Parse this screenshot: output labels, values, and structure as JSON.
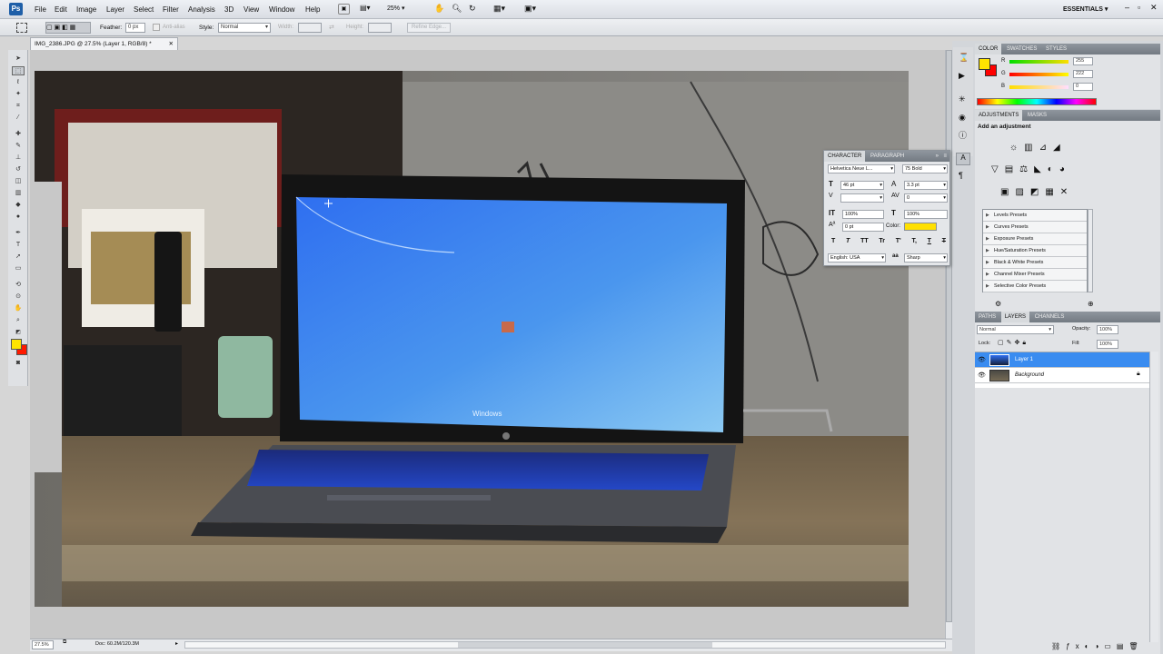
{
  "menubar": {
    "logo": "Ps",
    "items": [
      "File",
      "Edit",
      "Image",
      "Layer",
      "Select",
      "Filter",
      "Analysis",
      "3D",
      "View",
      "Window",
      "Help"
    ],
    "zoom": "25%",
    "workspace": "ESSENTIALS"
  },
  "options": {
    "feather_label": "Feather:",
    "feather_value": "0 px",
    "antialias_label": "Anti-alias",
    "style_label": "Style:",
    "style_value": "Normal",
    "width_label": "Width:",
    "height_label": "Height:",
    "refine_edge": "Refine Edge..."
  },
  "document": {
    "tab_title": "IMG_2386.JPG @ 27.5% (Layer 1, RGB/8) *",
    "screen_text": "Windows"
  },
  "status": {
    "zoom": "27.5%",
    "doc_size": "Doc: 60.2M/120.3M"
  },
  "color_panel": {
    "tabs": [
      "COLOR",
      "SWATCHES",
      "STYLES"
    ],
    "r_label": "R",
    "g_label": "G",
    "b_label": "B",
    "r": "255",
    "g": "222",
    "b": "0",
    "foreground": "#ffe400",
    "background": "#ff0000"
  },
  "adjustments_panel": {
    "tabs": [
      "ADJUSTMENTS",
      "MASKS"
    ],
    "heading": "Add an adjustment",
    "presets": [
      "Levels Presets",
      "Curves Presets",
      "Exposure Presets",
      "Hue/Saturation Presets",
      "Black & White Presets",
      "Channel Mixer Presets",
      "Selective Color Presets"
    ]
  },
  "character_panel": {
    "tabs": [
      "CHARACTER",
      "PARAGRAPH"
    ],
    "font_family": "Helvetica Neue L...",
    "font_style": "75 Bold",
    "font_size": "46 pt",
    "leading": "3.3 pt",
    "tracking": "0",
    "vscale": "100%",
    "hscale": "100%",
    "baseline": "0 pt",
    "color_label": "Color:",
    "color": "#ffe000",
    "language": "English: USA",
    "aa_label": "aa",
    "antialias": "Sharp",
    "style_buttons": [
      "T",
      "T",
      "TT",
      "Tr",
      "T'",
      "T,",
      "T",
      "T"
    ]
  },
  "layers_panel": {
    "tabs": [
      "PATHS",
      "LAYERS",
      "CHANNELS"
    ],
    "blend_mode": "Normal",
    "opacity_label": "Opacity:",
    "opacity": "100%",
    "lock_label": "Lock:",
    "fill_label": "Fill:",
    "fill": "100%",
    "layers": [
      "Layer 1",
      "Background"
    ]
  }
}
